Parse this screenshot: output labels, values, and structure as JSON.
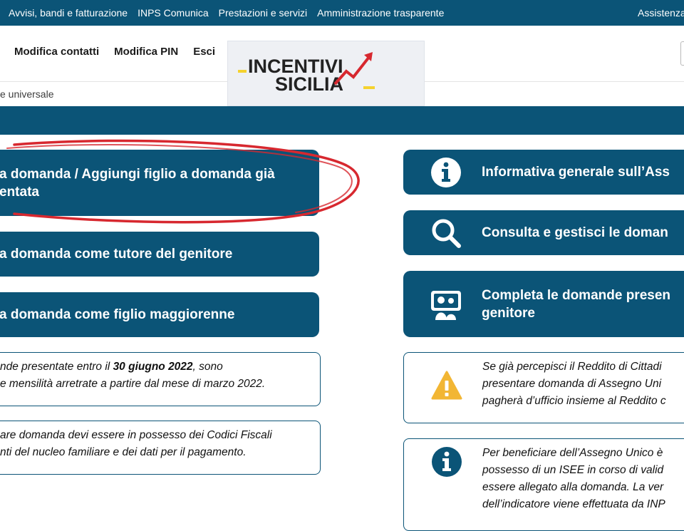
{
  "topbar": {
    "nav": [
      "Avvisi, bandi e fatturazione",
      "INPS Comunica",
      "Prestazioni e servizi",
      "Amministrazione trasparente"
    ],
    "assistance": "Assistenza"
  },
  "user_menu": {
    "edit_contacts": "Modifica contatti",
    "edit_pin": "Modifica PIN",
    "logout": "Esci"
  },
  "logo": {
    "line1": "INCENTIVI",
    "line2": "SICILIA"
  },
  "breadcrumb": {
    "current": "e universale"
  },
  "actions_left": [
    {
      "line1": "a domanda / Aggiungi figlio a domanda già",
      "line2": "entata"
    },
    {
      "line1": "a domanda come tutore del genitore"
    },
    {
      "line1": "a domanda come figlio maggiorenne"
    }
  ],
  "actions_right": [
    {
      "line1": "Informativa generale sull’Ass",
      "icon": "info-icon"
    },
    {
      "line1": "Consulta e gestisci le doman",
      "icon": "search-icon"
    },
    {
      "line1": "Completa le domande presen",
      "line2": "genitore",
      "icon": "parent-child-icon"
    }
  ],
  "notes_left": [
    {
      "line1_pre": "nde presentate entro il ",
      "line1_bold": "30 giugno 2022",
      "line1_post": ", sono",
      "line2": "e mensilità arretrate a partire dal mese di marzo 2022."
    },
    {
      "line1": "are domanda devi essere in possesso dei Codici Fiscali",
      "line2": "nti del nucleo familiare e dei dati per il pagamento."
    }
  ],
  "notes_right": [
    {
      "line1": "Se già percepisci il Reddito di Cittadi",
      "line2": "presentare domanda di Assegno Uni",
      "line3": "pagherà d’ufficio insieme al Reddito c",
      "icon": "warning-icon"
    },
    {
      "line1": "Per beneficiare dell’Assegno Unico è",
      "line2": "possesso di un ISEE in corso di valid",
      "line3": "essere allegato alla domanda. La ver",
      "line4": "dell’indicatore viene effettuata da INP",
      "icon": "info-icon"
    }
  ],
  "colors": {
    "primary": "#0b5477",
    "warning": "#f2b634",
    "annotation": "#d7282f"
  }
}
